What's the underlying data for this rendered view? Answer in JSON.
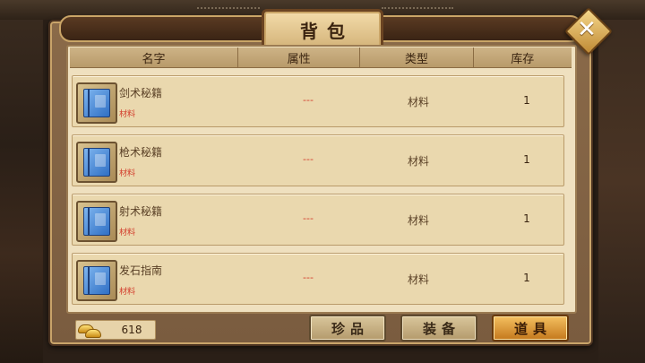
{
  "window": {
    "title": "背包",
    "close_label": "✕"
  },
  "table": {
    "headers": {
      "name": "名字",
      "attr": "属性",
      "type": "类型",
      "stock": "库存"
    },
    "rows": [
      {
        "name": "剑术秘籍",
        "tag": "材料",
        "attr": "---",
        "type": "材料",
        "stock": "1",
        "icon": "book-icon"
      },
      {
        "name": "枪术秘籍",
        "tag": "材料",
        "attr": "---",
        "type": "材料",
        "stock": "1",
        "icon": "book-icon"
      },
      {
        "name": "射术秘籍",
        "tag": "材料",
        "attr": "---",
        "type": "材料",
        "stock": "1",
        "icon": "book-icon"
      },
      {
        "name": "发石指南",
        "tag": "材料",
        "attr": "---",
        "type": "材料",
        "stock": "1",
        "icon": "book-icon"
      }
    ]
  },
  "currency": {
    "icon": "gold-ingot-icon",
    "value": "618"
  },
  "tabs": [
    {
      "label": "珍品",
      "active": false
    },
    {
      "label": "装备",
      "active": false
    },
    {
      "label": "道具",
      "active": true
    }
  ],
  "colors": {
    "accent": "#d23a2a",
    "active_tab": "#f4c060",
    "panel": "#efe0bf"
  }
}
